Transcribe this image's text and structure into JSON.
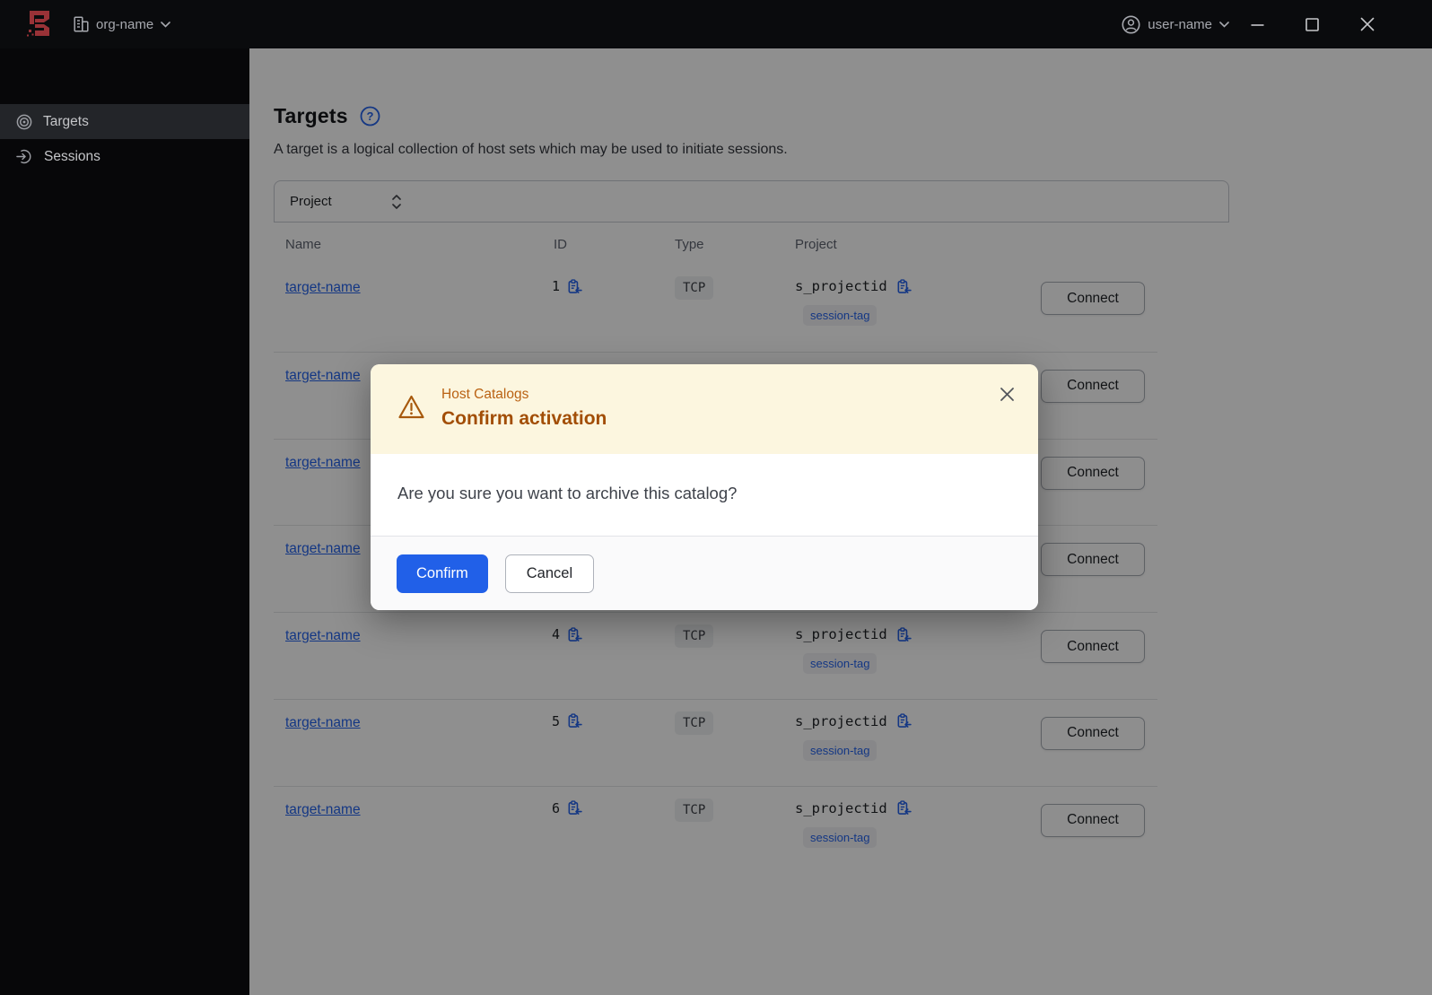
{
  "topbar": {
    "org_name": "org-name",
    "user_name": "user-name",
    "icons": {
      "logo": "boundary-logo",
      "org": "building-icon",
      "org_caret": "chevron-down-icon",
      "user": "user-circle-icon",
      "user_caret": "chevron-down-icon",
      "minimize": "minimize-icon",
      "maximize": "maximize-icon",
      "close": "close-icon"
    }
  },
  "sidebar": {
    "items": [
      {
        "label": "Targets",
        "icon": "target-icon",
        "active": true
      },
      {
        "label": "Sessions",
        "icon": "session-entry-icon",
        "active": false
      }
    ]
  },
  "page": {
    "title": "Targets",
    "help_icon": "help-icon",
    "description": "A target is a logical collection of host sets which may be used to initiate sessions.",
    "filter": {
      "label": "Project",
      "icon": "select-caret-icon"
    },
    "table": {
      "headers": [
        "Name",
        "ID",
        "Type",
        "Project"
      ],
      "connect_label": "Connect",
      "copy_icon": "clipboard-copy-icon",
      "rows": [
        {
          "name": "target-name",
          "id": "1",
          "type": "TCP",
          "project": "s_projectid",
          "tag": "session-tag"
        },
        {
          "name": "target-name",
          "id": "",
          "type": "",
          "project": "",
          "tag": ""
        },
        {
          "name": "target-name",
          "id": "",
          "type": "",
          "project": "",
          "tag": ""
        },
        {
          "name": "target-name",
          "id": "",
          "type": "",
          "project": "",
          "tag": ""
        },
        {
          "name": "target-name",
          "id": "4",
          "type": "TCP",
          "project": "s_projectid",
          "tag": "session-tag"
        },
        {
          "name": "target-name",
          "id": "5",
          "type": "TCP",
          "project": "s_projectid",
          "tag": "session-tag"
        },
        {
          "name": "target-name",
          "id": "6",
          "type": "TCP",
          "project": "s_projectid",
          "tag": "session-tag"
        }
      ]
    }
  },
  "modal": {
    "context": "Host Catalogs",
    "title": "Confirm activation",
    "message": "Are you sure you want to archive this catalog?",
    "confirm_label": "Confirm",
    "cancel_label": "Cancel",
    "warning_icon": "alert-triangle-icon",
    "close_icon": "close-icon"
  },
  "colors": {
    "accent_blue": "#2563eb",
    "brand_red": "#993237",
    "warning_surface": "#fcf6df",
    "warning_title": "#a24e06",
    "warning_context": "#ba6213",
    "overlay": "rgba(0,0,0,0.44)",
    "topbar_bg": "#0a0b0d",
    "sidebar_bg": "#070709"
  }
}
